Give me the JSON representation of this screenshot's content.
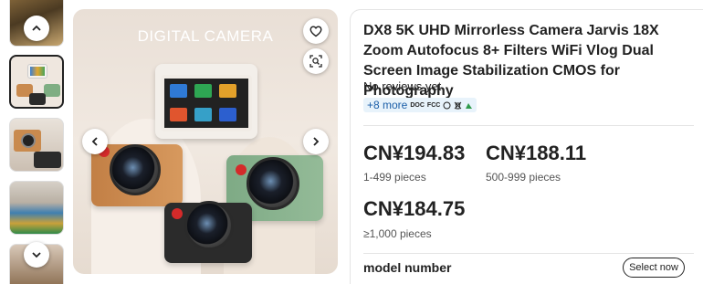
{
  "gallery": {
    "overlay_title": "DIGITAL CAMERA",
    "thumbnails": [
      "thumbnail-1",
      "thumbnail-2",
      "thumbnail-3",
      "thumbnail-4",
      "thumbnail-5"
    ],
    "active_thumbnail": 1,
    "icons": {
      "up": "chevron-up-icon",
      "down": "chevron-down-icon",
      "prev": "chevron-left-icon",
      "next": "chevron-right-icon",
      "favorite": "heart-icon",
      "visual_search": "image-search-icon"
    }
  },
  "product": {
    "title": "DX8 5K UHD Mirrorless Camera Jarvis 18X Zoom Autofocus 8+ Filters WiFi Vlog Dual Screen Image Stabilization CMOS for Photography",
    "reviews": "No reviews yet",
    "certifications": {
      "more": "+8 more",
      "marks": [
        "DOC",
        "FCC"
      ]
    },
    "prices": [
      {
        "price": "CN¥194.83",
        "quantity": "1-499 pieces"
      },
      {
        "price": "CN¥188.11",
        "quantity": "500-999 pieces"
      },
      {
        "price": "CN¥184.75",
        "quantity": "≥1,000 pieces"
      }
    ],
    "model_label": "model number",
    "select_button": "Select now"
  },
  "colors": {
    "text": "#222222",
    "cert_bg": "#e8f3fb",
    "cert_text": "#1b5ea8"
  }
}
